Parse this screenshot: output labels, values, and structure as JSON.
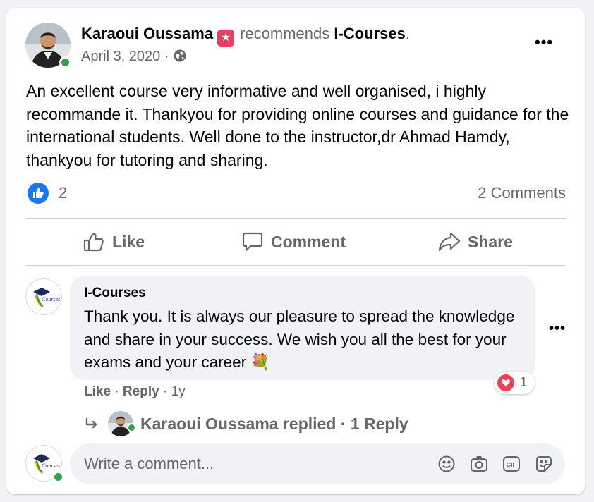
{
  "post": {
    "author": "Karaoui Oussama",
    "recommends_text": "recommends",
    "page_name": "I-Courses",
    "period": ".",
    "date": "April 3, 2020",
    "date_separator": "·",
    "body": "An excellent course very informative and well organised, i highly recommande it. Thankyou for providing online courses and guidance for the international students. Well done to the instructor,dr Ahmad Hamdy, thankyou for tutoring and sharing.",
    "reaction_count": "2",
    "comments_count": "2 Comments",
    "more_icon": "more-horizontal-icon",
    "privacy_icon": "globe-icon"
  },
  "actions": {
    "like": "Like",
    "comment": "Comment",
    "share": "Share"
  },
  "comment": {
    "author": "I-Courses",
    "text": "Thank you. It is always our pleasure to spread the knowledge and share in your success. We wish you all the best for your exams and your career",
    "emoji": "💐",
    "like_label": "Like",
    "separator": "·",
    "reply_label": "Reply",
    "age": "1y",
    "reaction_count": "1",
    "reaction_icon": "love-heart-icon"
  },
  "reply_preview": {
    "text": "Karaoui Oussama replied · 1 Reply"
  },
  "composer": {
    "placeholder": "Write a comment..."
  },
  "logo": {
    "text": "Courses"
  },
  "colors": {
    "brand_blue": "#1877f2",
    "online_green": "#31a24c",
    "heart_red": "#f33e58",
    "secondary_text": "#65676b",
    "badge_pink": "#e4405f"
  }
}
